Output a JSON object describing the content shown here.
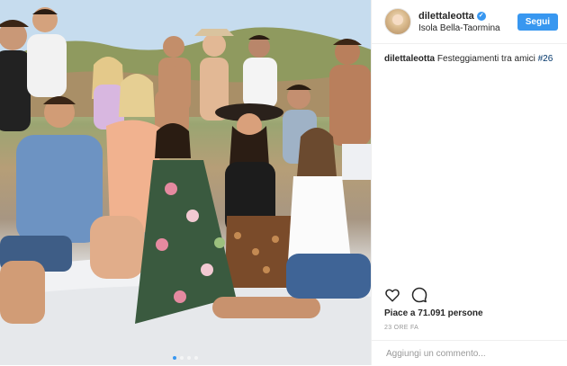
{
  "post": {
    "username": "dilettaleotta",
    "verified": true,
    "location": "Isola Bella-Taormina",
    "follow_label": "Segui",
    "caption": {
      "username": "dilettaleotta",
      "text": "Festeggiamenti tra amici",
      "hashtag": "#26"
    },
    "likes": "Piace a 71.091 persone",
    "time_ago": "23 ORE FA",
    "comment_placeholder": "Aggiungi un commento...",
    "carousel": {
      "count": 4,
      "active_index": 0
    }
  },
  "icons": {
    "like": "heart-icon",
    "comment": "comment-bubble-icon",
    "verified": "verified-badge-icon"
  },
  "colors": {
    "accent": "#3897f0",
    "text": "#262626",
    "muted": "#999999",
    "hashtag": "#003569",
    "border": "#efefef"
  }
}
